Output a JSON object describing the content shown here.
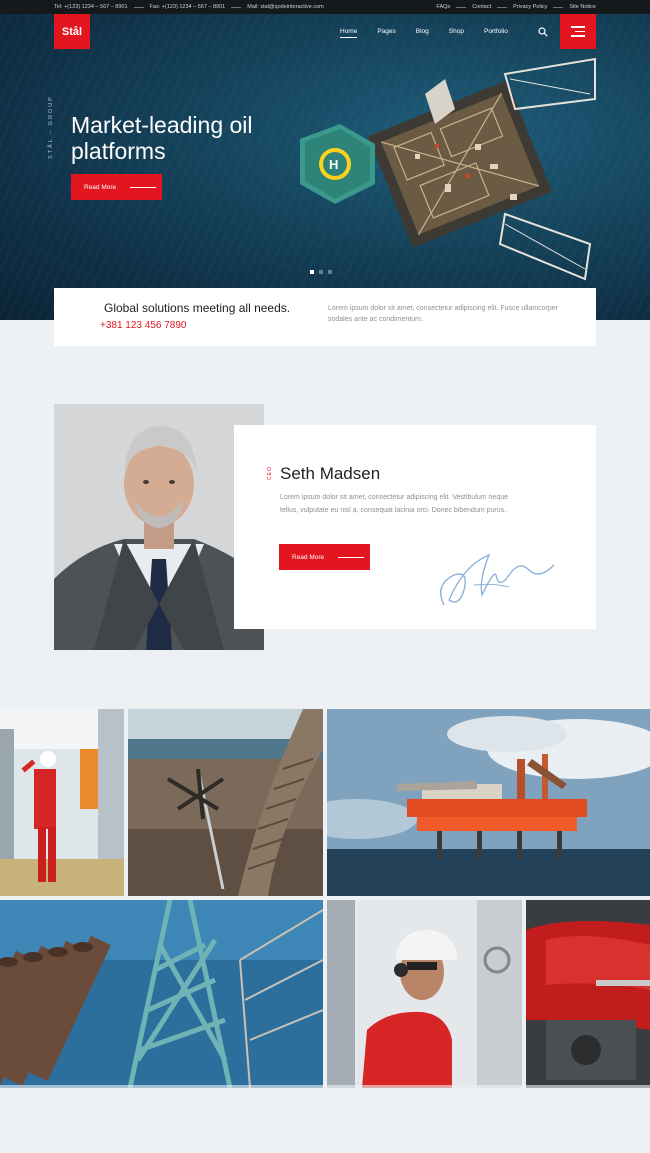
{
  "topbar": {
    "tel": "Tel: +(123) 1234 – 567 – 8901",
    "fax": "Fax: +(123) 1234 – 567 – 8901",
    "mail": "Mail: stal@qodeinteractive.com",
    "links": [
      "FAQs",
      "Contact",
      "Privacy Policy",
      "Site Notice"
    ]
  },
  "header": {
    "logo": "Stål",
    "nav": [
      "Home",
      "Pages",
      "Blog",
      "Shop",
      "Portfolio"
    ],
    "active_nav": "Home"
  },
  "hero": {
    "vertical_label": "STÅL – GROUP",
    "title": "Market-leading oil platforms",
    "button": "Read More",
    "slides": 3,
    "active_slide": 1
  },
  "strip": {
    "heading": "Global solutions meeting all needs.",
    "phone": "+381 123 456 7890",
    "text": "Lorem ipsum dolor sit amet, consectetur adipiscing elit. Fusce ullamcorper sodales ante ac condimentum."
  },
  "profile": {
    "vertical_label": "CEO",
    "name": "Seth Madsen",
    "text": "Lorem ipsum dolor sit amet, consectetur adipiscing elit. Vestibulum neque tellus, vulputate eu nisl a, consequat lacinia orci. Donec bibendum purus.",
    "button": "Read More"
  },
  "colors": {
    "accent": "#e3161f",
    "topbar": "#15191c",
    "page_bg": "#eef1f4"
  }
}
